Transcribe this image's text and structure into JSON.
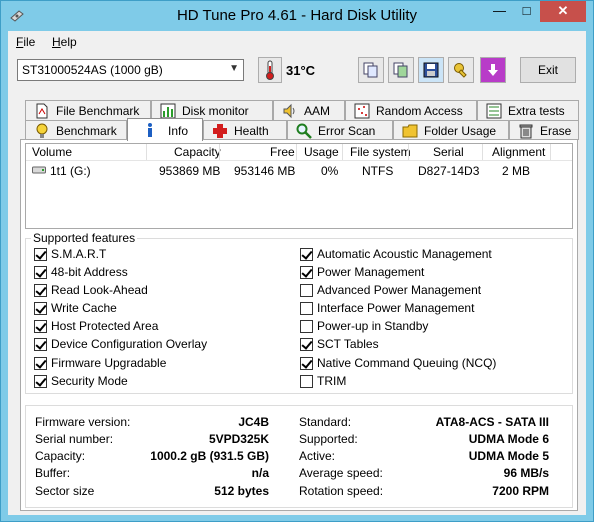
{
  "window": {
    "title": "HD Tune Pro 4.61 - Hard Disk Utility",
    "min_glyph": "—",
    "max_glyph": "□",
    "close_glyph": "✕"
  },
  "menu": {
    "file_ul": "F",
    "file_rest": "ile",
    "help_ul": "H",
    "help_rest": "elp"
  },
  "toolbar": {
    "drive": "ST31000524AS (1000 gB)",
    "temperature": "31°C",
    "exit_label": "Exit"
  },
  "tabs_top": [
    {
      "label": "File Benchmark",
      "icon": "file-benchmark-icon"
    },
    {
      "label": "Disk monitor",
      "icon": "disk-monitor-icon"
    },
    {
      "label": "AAM",
      "icon": "speaker-icon"
    },
    {
      "label": "Random Access",
      "icon": "random-access-icon"
    },
    {
      "label": "Extra tests",
      "icon": "extra-tests-icon"
    }
  ],
  "tabs_bottom": [
    {
      "label": "Benchmark",
      "icon": "lightbulb-icon"
    },
    {
      "label": "Info",
      "icon": "info-icon",
      "active": true
    },
    {
      "label": "Health",
      "icon": "health-cross-icon"
    },
    {
      "label": "Error Scan",
      "icon": "magnifier-icon"
    },
    {
      "label": "Folder Usage",
      "icon": "folder-icon"
    },
    {
      "label": "Erase",
      "icon": "trash-icon"
    }
  ],
  "volumes": {
    "columns": [
      "Volume",
      "Capacity",
      "Free",
      "Usage",
      "File system",
      "Serial",
      "Alignment"
    ],
    "rows": [
      {
        "volume": "1t1 (G:)",
        "capacity": "953869 MB",
        "free": "953146 MB",
        "usage": "0%",
        "fs": "NTFS",
        "serial": "D827-14D3",
        "alignment": "2 MB"
      }
    ]
  },
  "features": {
    "title": "Supported features",
    "left": [
      {
        "label": "S.M.A.R.T",
        "checked": true
      },
      {
        "label": "48-bit Address",
        "checked": true
      },
      {
        "label": "Read Look-Ahead",
        "checked": true
      },
      {
        "label": "Write Cache",
        "checked": true
      },
      {
        "label": "Host Protected Area",
        "checked": true
      },
      {
        "label": "Device Configuration Overlay",
        "checked": true
      },
      {
        "label": "Firmware Upgradable",
        "checked": true
      },
      {
        "label": "Security Mode",
        "checked": true
      }
    ],
    "right": [
      {
        "label": "Automatic Acoustic Management",
        "checked": true
      },
      {
        "label": "Power Management",
        "checked": true
      },
      {
        "label": "Advanced Power Management",
        "checked": false
      },
      {
        "label": "Interface Power Management",
        "checked": false
      },
      {
        "label": "Power-up in Standby",
        "checked": false
      },
      {
        "label": "SCT Tables",
        "checked": true
      },
      {
        "label": "Native Command Queuing (NCQ)",
        "checked": true
      },
      {
        "label": "TRIM",
        "checked": false
      }
    ]
  },
  "info": {
    "left": [
      {
        "label": "Firmware version:",
        "value": "JC4B"
      },
      {
        "label": "Serial number:",
        "value": "5VPD325K"
      },
      {
        "label": "Capacity:",
        "value": "1000.2 gB (931.5 GB)"
      },
      {
        "label": "Buffer:",
        "value": "n/a"
      },
      {
        "label": "Sector size",
        "value": "512 bytes"
      }
    ],
    "right": [
      {
        "label": "Standard:",
        "value": "ATA8-ACS - SATA III"
      },
      {
        "label": "Supported:",
        "value": "UDMA Mode 6"
      },
      {
        "label": "Active:",
        "value": "UDMA Mode 5"
      },
      {
        "label": "Average speed:",
        "value": "96 MB/s"
      },
      {
        "label": "Rotation speed:",
        "value": "7200 RPM"
      }
    ]
  }
}
